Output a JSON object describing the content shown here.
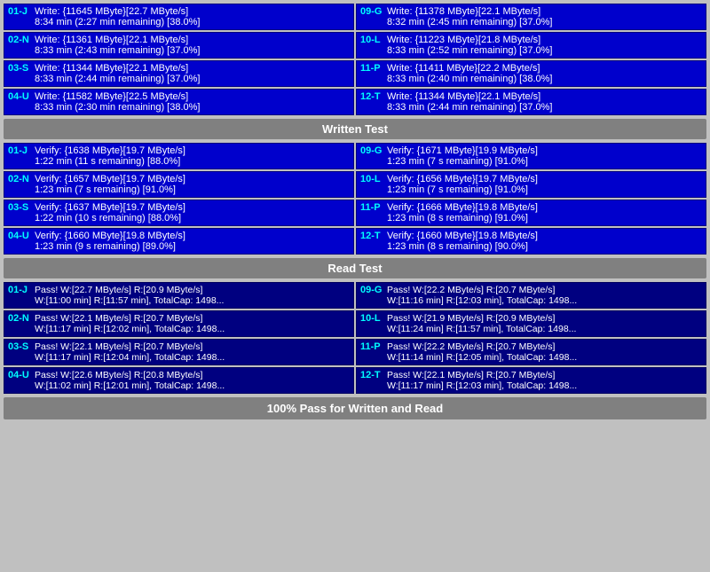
{
  "sections": {
    "write_test": {
      "label": "Written Test",
      "left_cards": [
        {
          "id": "01-J",
          "line1": "Write: {11645 MByte}[22.7 MByte/s]",
          "line2": "8:34 min (2:27 min remaining)  [38.0%]"
        },
        {
          "id": "02-N",
          "line1": "Write: {11361 MByte}[22.1 MByte/s]",
          "line2": "8:33 min (2:43 min remaining)  [37.0%]"
        },
        {
          "id": "03-S",
          "line1": "Write: {11344 MByte}[22.1 MByte/s]",
          "line2": "8:33 min (2:44 min remaining)  [37.0%]"
        },
        {
          "id": "04-U",
          "line1": "Write: {11582 MByte}[22.5 MByte/s]",
          "line2": "8:33 min (2:30 min remaining)  [38.0%]"
        }
      ],
      "right_cards": [
        {
          "id": "09-G",
          "line1": "Write: {11378 MByte}[22.1 MByte/s]",
          "line2": "8:32 min (2:45 min remaining)  [37.0%]"
        },
        {
          "id": "10-L",
          "line1": "Write: {11223 MByte}[21.8 MByte/s]",
          "line2": "8:33 min (2:52 min remaining)  [37.0%]"
        },
        {
          "id": "11-P",
          "line1": "Write: {11411 MByte}[22.2 MByte/s]",
          "line2": "8:33 min (2:40 min remaining)  [38.0%]"
        },
        {
          "id": "12-T",
          "line1": "Write: {11344 MByte}[22.1 MByte/s]",
          "line2": "8:33 min (2:44 min remaining)  [37.0%]"
        }
      ]
    },
    "verify_test": {
      "label": "Written Test",
      "left_cards": [
        {
          "id": "01-J",
          "line1": "Verify: {1638 MByte}[19.7 MByte/s]",
          "line2": "1:22 min (11 s remaining)   [88.0%]"
        },
        {
          "id": "02-N",
          "line1": "Verify: {1657 MByte}[19.7 MByte/s]",
          "line2": "1:23 min (7 s remaining)   [91.0%]"
        },
        {
          "id": "03-S",
          "line1": "Verify: {1637 MByte}[19.7 MByte/s]",
          "line2": "1:22 min (10 s remaining)   [88.0%]"
        },
        {
          "id": "04-U",
          "line1": "Verify: {1660 MByte}[19.8 MByte/s]",
          "line2": "1:23 min (9 s remaining)   [89.0%]"
        }
      ],
      "right_cards": [
        {
          "id": "09-G",
          "line1": "Verify: {1671 MByte}[19.9 MByte/s]",
          "line2": "1:23 min (7 s remaining)   [91.0%]"
        },
        {
          "id": "10-L",
          "line1": "Verify: {1656 MByte}[19.7 MByte/s]",
          "line2": "1:23 min (7 s remaining)   [91.0%]"
        },
        {
          "id": "11-P",
          "line1": "Verify: {1666 MByte}[19.8 MByte/s]",
          "line2": "1:23 min (8 s remaining)   [91.0%]"
        },
        {
          "id": "12-T",
          "line1": "Verify: {1660 MByte}[19.8 MByte/s]",
          "line2": "1:23 min (8 s remaining)   [90.0%]"
        }
      ]
    },
    "read_test": {
      "label": "Read Test",
      "left_cards": [
        {
          "id": "01-J",
          "line1": "Pass! W:[22.7 MByte/s] R:[20.9 MByte/s]",
          "line2": "W:[11:00 min] R:[11:57 min], TotalCap: 1498..."
        },
        {
          "id": "02-N",
          "line1": "Pass! W:[22.1 MByte/s] R:[20.7 MByte/s]",
          "line2": "W:[11:17 min] R:[12:02 min], TotalCap: 1498..."
        },
        {
          "id": "03-S",
          "line1": "Pass! W:[22.1 MByte/s] R:[20.7 MByte/s]",
          "line2": "W:[11:17 min] R:[12:04 min], TotalCap: 1498..."
        },
        {
          "id": "04-U",
          "line1": "Pass! W:[22.6 MByte/s] R:[20.8 MByte/s]",
          "line2": "W:[11:02 min] R:[12:01 min], TotalCap: 1498..."
        }
      ],
      "right_cards": [
        {
          "id": "09-G",
          "line1": "Pass! W:[22.2 MByte/s] R:[20.7 MByte/s]",
          "line2": "W:[11:16 min] R:[12:03 min], TotalCap: 1498..."
        },
        {
          "id": "10-L",
          "line1": "Pass! W:[21.9 MByte/s] R:[20.9 MByte/s]",
          "line2": "W:[11:24 min] R:[11:57 min], TotalCap: 1498..."
        },
        {
          "id": "11-P",
          "line1": "Pass! W:[22.2 MByte/s] R:[20.7 MByte/s]",
          "line2": "W:[11:14 min] R:[12:05 min], TotalCap: 1498..."
        },
        {
          "id": "12-T",
          "line1": "Pass! W:[22.1 MByte/s] R:[20.7 MByte/s]",
          "line2": "W:[11:17 min] R:[12:03 min], TotalCap: 1498..."
        }
      ]
    }
  },
  "headers": {
    "written_test": "Written Test",
    "read_test": "Read Test"
  },
  "footer": "100% Pass for Written and Read"
}
